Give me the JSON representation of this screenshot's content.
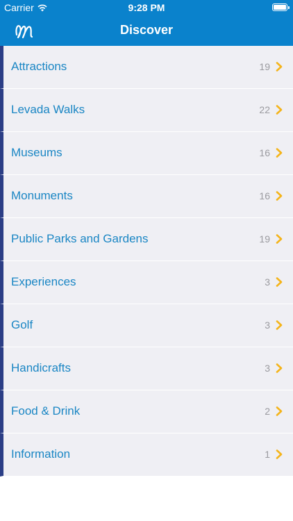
{
  "status_bar": {
    "carrier": "Carrier",
    "time": "9:28 PM",
    "icons": [
      "wifi-icon",
      "battery-icon"
    ]
  },
  "nav": {
    "title": "Discover",
    "logo": "madeira-logo-icon"
  },
  "colors": {
    "header": "#0a82cc",
    "row_background": "#efeff4",
    "row_accent": "#2b3e86",
    "label": "#1a86c4",
    "count": "#9a9a9f",
    "chevron": "#f4b41a"
  },
  "categories": [
    {
      "label": "Attractions",
      "count": "19"
    },
    {
      "label": "Levada Walks",
      "count": "22"
    },
    {
      "label": "Museums",
      "count": "16"
    },
    {
      "label": "Monuments",
      "count": "16"
    },
    {
      "label": "Public Parks and Gardens",
      "count": "19"
    },
    {
      "label": "Experiences",
      "count": "3"
    },
    {
      "label": "Golf",
      "count": "3"
    },
    {
      "label": "Handicrafts",
      "count": "3"
    },
    {
      "label": "Food & Drink",
      "count": "2"
    },
    {
      "label": "Information",
      "count": "1"
    }
  ]
}
